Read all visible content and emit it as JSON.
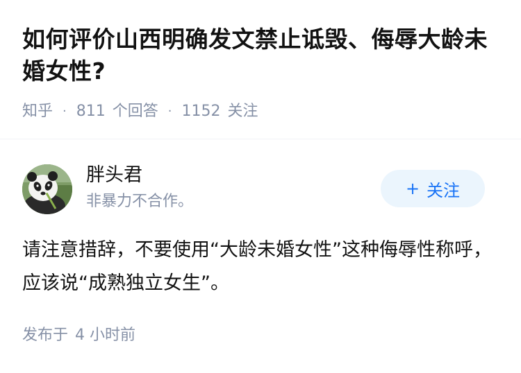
{
  "question": {
    "title": "如何评价山西明确发文禁止诋毁、侮辱大龄未婚女性?",
    "site": "知乎",
    "answer_count": "811",
    "answer_label": "个回答",
    "follower_count": "1152",
    "follower_label": "关注"
  },
  "author": {
    "name": "胖头君",
    "bio": "非暴力不合作。",
    "avatar_icon": "panda-avatar-icon",
    "follow_plus": "+",
    "follow_label": "关注"
  },
  "answer": {
    "content": "请注意措辞，不要使用“大龄未婚女性”这种侮辱性称呼，应该说“成熟独立女生”。",
    "time_prefix": "发布于",
    "time_value": "4 小时前"
  },
  "colors": {
    "text": "#121212",
    "muted": "#8590a6",
    "accent": "#1772f6",
    "follow_bg": "#ebf5fd"
  }
}
